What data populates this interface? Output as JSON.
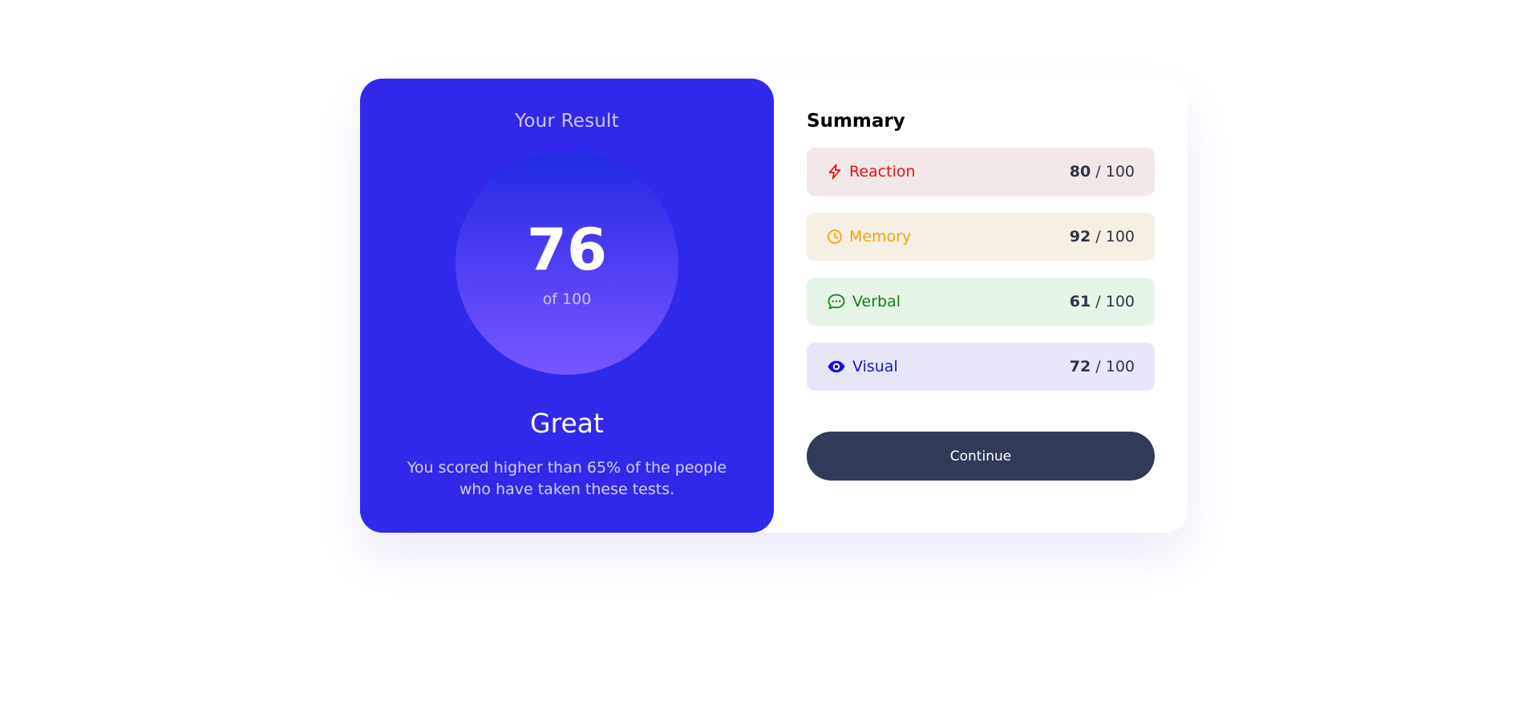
{
  "result": {
    "title": "Your Result",
    "score": "76",
    "score_of": "of 100",
    "grade": "Great",
    "description": "You scored higher than 65% of the people who have taken these tests."
  },
  "summary": {
    "title": "Summary",
    "items": [
      {
        "label": "Reaction",
        "score": "80",
        "max": " / 100",
        "icon": "lightning-icon",
        "color": "#f00c0c"
      },
      {
        "label": "Memory",
        "score": "92",
        "max": " / 100",
        "icon": "clock-icon",
        "color": "#f3a30a"
      },
      {
        "label": "Verbal",
        "score": "61",
        "max": " / 100",
        "icon": "chat-bubble-icon",
        "color": "#0e7f15"
      },
      {
        "label": "Visual",
        "score": "72",
        "max": " / 100",
        "icon": "eye-icon",
        "color": "#1a0fdf"
      }
    ],
    "continue_label": "Continue"
  },
  "colors": {
    "result_panel": "#3029ea",
    "continue_button": "#313a57"
  }
}
